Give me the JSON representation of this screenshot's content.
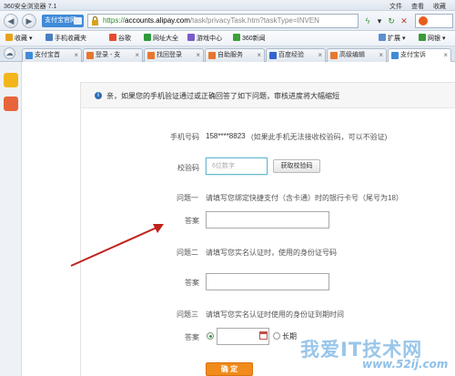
{
  "browser": {
    "title": "360安全浏览器 7.1",
    "menu": [
      "文件",
      "查看",
      "收藏"
    ],
    "site_badge": "支付宝官网",
    "url": {
      "scheme": "https://",
      "host": "accounts.alipay.com",
      "path": "/task/privacyTask.htm?taskType=INVEN"
    }
  },
  "bookmarks": {
    "items": [
      {
        "label": "收藏",
        "icon": "star-icon",
        "color": "#e8a21c"
      },
      {
        "label": "手机收藏夹",
        "icon": "phone-icon",
        "color": "#4a7fc1"
      },
      {
        "label": "谷歌",
        "icon": "google-icon",
        "color": "#e94a2e"
      },
      {
        "label": "网址大全",
        "icon": "globe-icon",
        "color": "#2f9a3a"
      },
      {
        "label": "游戏中心",
        "icon": "game-icon",
        "color": "#7a5bc8"
      },
      {
        "label": "360新闻",
        "icon": "360-icon",
        "color": "#3aa03a"
      }
    ],
    "right_items": [
      "扩展",
      "网银"
    ]
  },
  "tabs": [
    {
      "label": "支付宝首",
      "color": "#3f8bd8",
      "active": false
    },
    {
      "label": "登录 - 支",
      "color": "#e8772e",
      "active": false
    },
    {
      "label": "找回登录",
      "color": "#e8772e",
      "active": false
    },
    {
      "label": "自助服务",
      "color": "#e8772e",
      "active": false
    },
    {
      "label": "百度经验",
      "color": "#3366cc",
      "active": false
    },
    {
      "label": "高级编辑",
      "color": "#e8772e",
      "active": false
    },
    {
      "label": "支付宝诉",
      "color": "#3f8bd8",
      "active": true
    }
  ],
  "notice": {
    "message": "亲，如果您的手机验证通过或正确回答了如下问题，审核进度将大幅缩短"
  },
  "form": {
    "phone": {
      "label": "手机号码",
      "value": "158****8823",
      "note": "(如果此手机无法接收校验码，可以不验证)"
    },
    "code": {
      "label": "校验码",
      "placeholder": "6位数字",
      "button": "获取校验码"
    },
    "q1": {
      "label": "问题一",
      "text": "请填写您绑定快捷支付（含卡通）时的银行卡号（尾号为18）",
      "answer_label": "答案"
    },
    "q2": {
      "label": "问题二",
      "text": "请填写您实名认证时，使用的身份证号码",
      "answer_label": "答案"
    },
    "q3": {
      "label": "问题三",
      "text": "请填写您实名认证时使用的身份证到期时间",
      "answer_label": "答案",
      "option_long": "长期"
    },
    "confirm": "确 定"
  },
  "watermark": {
    "text": "我爱IT技术网",
    "url": "www.52ij.com"
  }
}
